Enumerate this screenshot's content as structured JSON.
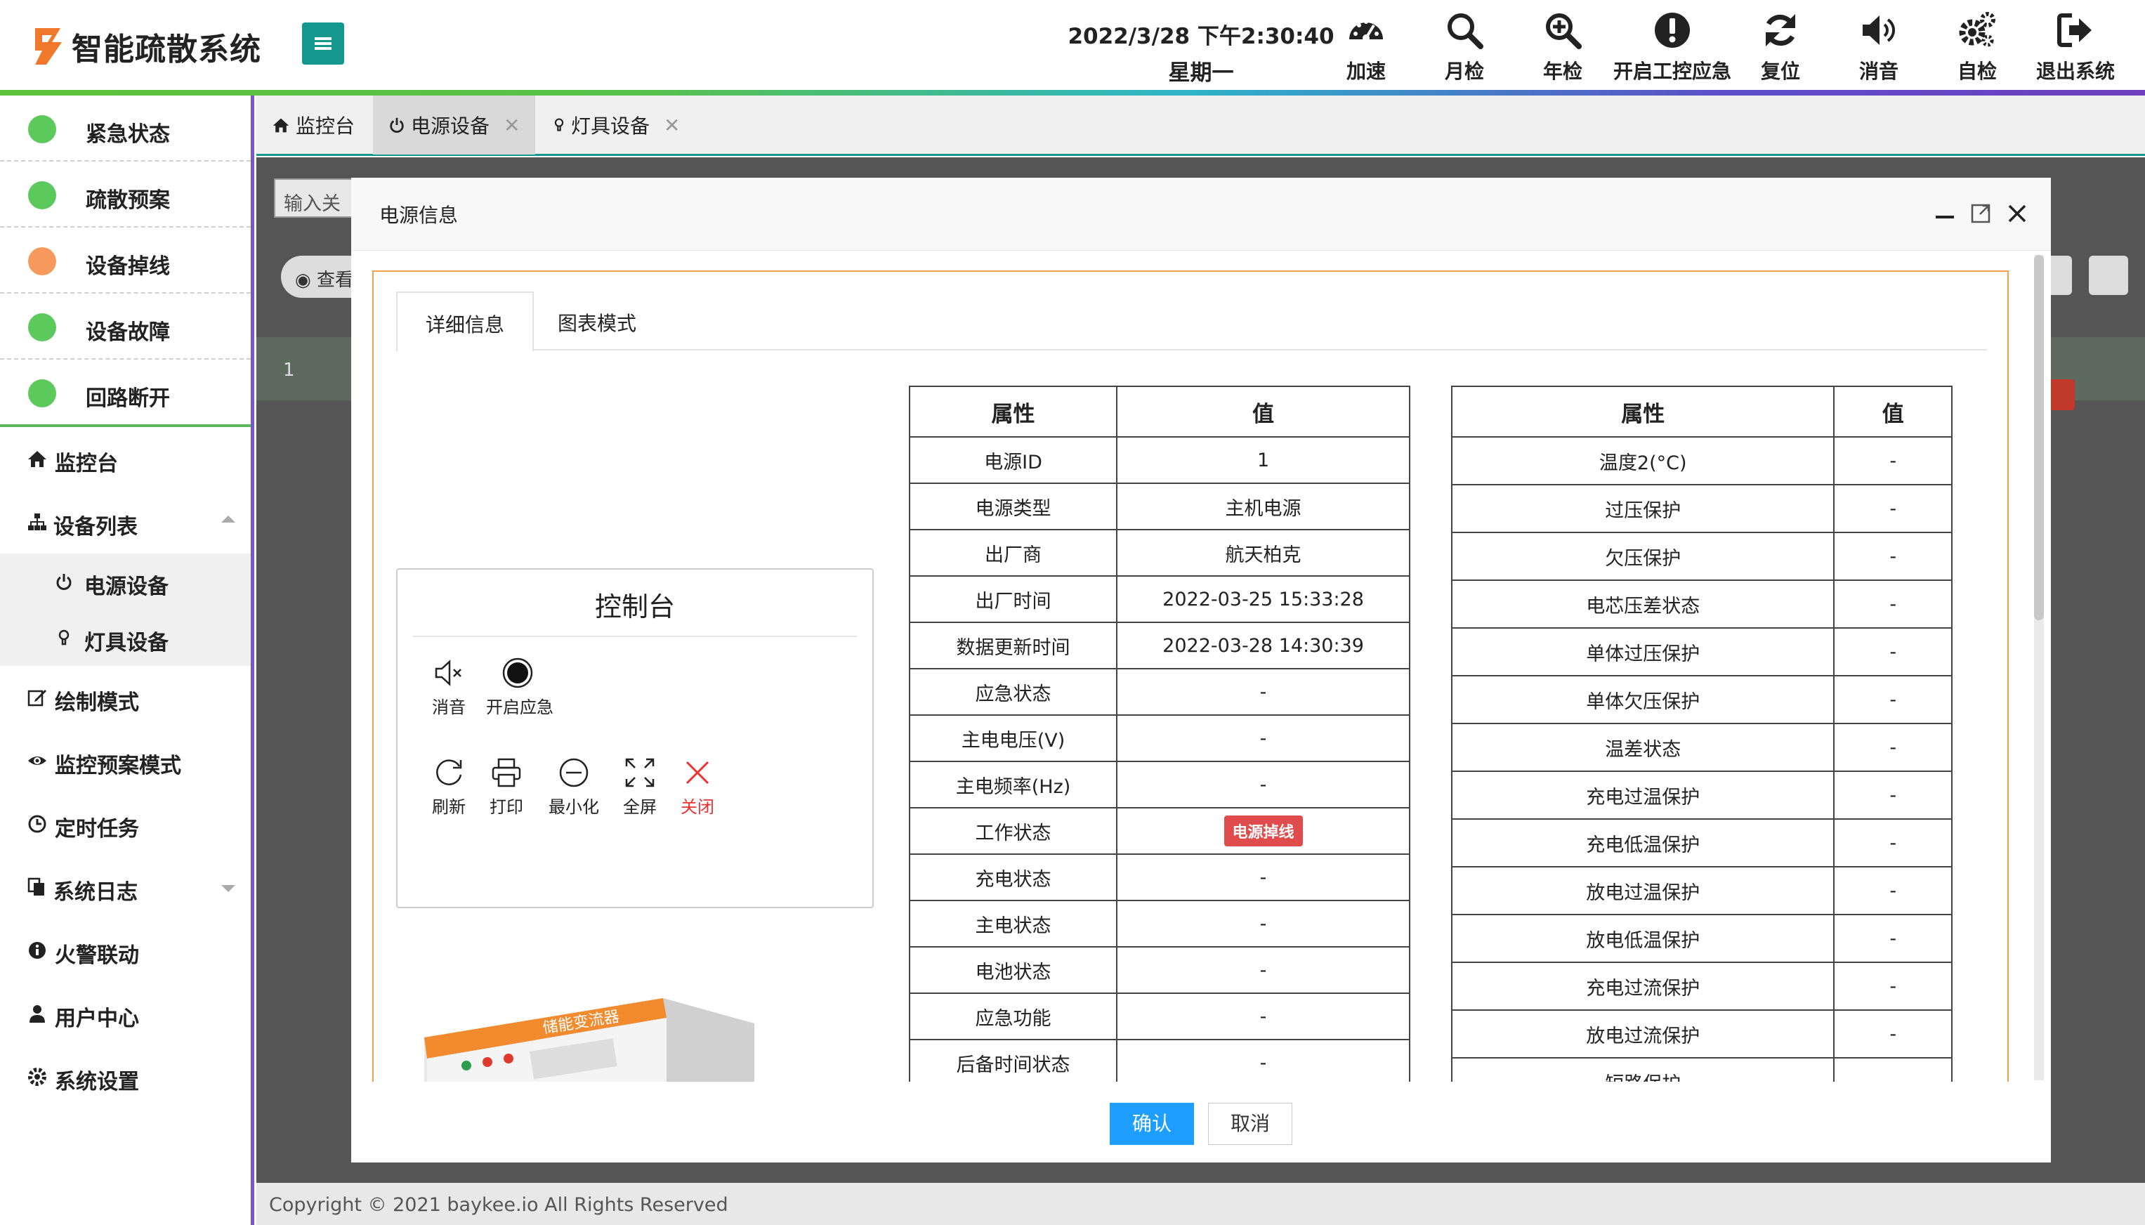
{
  "header": {
    "app_title": "智能疏散系统",
    "date_time": "2022/3/28 下午2:30:40",
    "weekday": "星期一",
    "tools": [
      {
        "icon": "speedometer-icon",
        "label": "加速"
      },
      {
        "icon": "search-icon",
        "label": "月检"
      },
      {
        "icon": "zoom-in-icon",
        "label": "年检"
      },
      {
        "icon": "exclamation-icon",
        "label": "开启工控应急"
      },
      {
        "icon": "refresh-icon",
        "label": "复位"
      },
      {
        "icon": "volume-icon",
        "label": "消音"
      },
      {
        "icon": "gears-icon",
        "label": "自检"
      },
      {
        "icon": "sign-out-icon",
        "label": "退出系统"
      }
    ]
  },
  "sidebar": {
    "status_items": [
      {
        "label": "紧急状态",
        "color": "#5cc95c"
      },
      {
        "label": "疏散预案",
        "color": "#5cc95c"
      },
      {
        "label": "设备掉线",
        "color": "#f59a5c"
      },
      {
        "label": "设备故障",
        "color": "#5cc95c"
      },
      {
        "label": "回路断开",
        "color": "#5cc95c"
      }
    ],
    "nav": {
      "monitor": "监控台",
      "device_list": "设备列表",
      "power_device": "电源设备",
      "lamp_device": "灯具设备",
      "draw_mode": "绘制模式",
      "plan_mode": "监控预案模式",
      "scheduled_tasks": "定时任务",
      "system_log": "系统日志",
      "fire_linkage": "火警联动",
      "user_center": "用户中心",
      "system_settings": "系统设置"
    }
  },
  "page_tabs": [
    "监控台",
    "电源设备",
    "灯具设备"
  ],
  "background": {
    "search_placeholder": "输入关",
    "view_button": "查看",
    "row_index": "1"
  },
  "modal": {
    "title": "电源信息",
    "tabs": [
      "详细信息",
      "图表模式"
    ],
    "control_panel": {
      "title": "控制台",
      "buttons": [
        "消音",
        "开启应急",
        "刷新",
        "打印",
        "最小化",
        "全屏",
        "关闭"
      ]
    },
    "device_label": "储能变流器",
    "table1": {
      "headers": [
        "属性",
        "值"
      ],
      "rows": [
        [
          "电源ID",
          "1"
        ],
        [
          "电源类型",
          "主机电源"
        ],
        [
          "出厂商",
          "航天柏克"
        ],
        [
          "出厂时间",
          "2022-03-25 15:33:28"
        ],
        [
          "数据更新时间",
          "2022-03-28 14:30:39"
        ],
        [
          "应急状态",
          "-"
        ],
        [
          "主电电压(V)",
          "-"
        ],
        [
          "主电频率(Hz)",
          "-"
        ],
        [
          "工作状态",
          "电源掉线"
        ],
        [
          "充电状态",
          "-"
        ],
        [
          "主电状态",
          "-"
        ],
        [
          "电池状态",
          "-"
        ],
        [
          "应急功能",
          "-"
        ],
        [
          "后备时间状态",
          "-"
        ]
      ]
    },
    "table2": {
      "headers": [
        "属性",
        "值"
      ],
      "rows": [
        [
          "温度2(°C)",
          "-"
        ],
        [
          "过压保护",
          "-"
        ],
        [
          "欠压保护",
          "-"
        ],
        [
          "电芯压差状态",
          "-"
        ],
        [
          "单体过压保护",
          "-"
        ],
        [
          "单体欠压保护",
          "-"
        ],
        [
          "温差状态",
          "-"
        ],
        [
          "充电过温保护",
          "-"
        ],
        [
          "充电低温保护",
          "-"
        ],
        [
          "放电过温保护",
          "-"
        ],
        [
          "放电低温保护",
          "-"
        ],
        [
          "充电过流保护",
          "-"
        ],
        [
          "放电过流保护",
          "-"
        ],
        [
          "短路保护",
          ""
        ]
      ]
    },
    "confirm": "确认",
    "cancel": "取消"
  },
  "footer": {
    "copyright": "Copyright © 2021   baykee.io   All Rights Reserved"
  }
}
